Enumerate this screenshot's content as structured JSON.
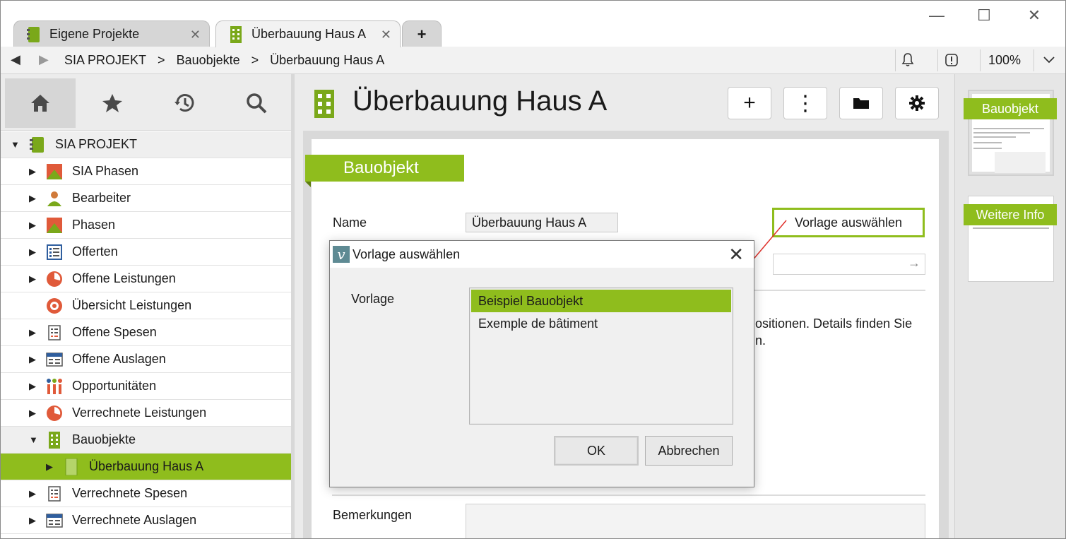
{
  "window": {
    "tabs": [
      {
        "label": "Eigene Projekte",
        "close": "✕"
      },
      {
        "label": "Überbauung Haus A",
        "close": "✕"
      }
    ],
    "new_tab": "+",
    "controls": {
      "minimize": "—",
      "maximize": "☐",
      "close": "✕"
    }
  },
  "navbar": {
    "back": "◀",
    "forward": "▶",
    "breadcrumb": [
      "SIA PROJEKT",
      "Bauobjekte",
      "Überbauung Haus A"
    ],
    "separator": ">",
    "zoom": "100%",
    "dropdown": "⌄"
  },
  "sidebar": {
    "tabs": [
      "home-icon",
      "star-icon",
      "history-icon",
      "search-icon"
    ],
    "root": "SIA PROJEKT",
    "items": [
      {
        "label": "SIA Phasen"
      },
      {
        "label": "Bearbeiter"
      },
      {
        "label": "Phasen"
      },
      {
        "label": "Offerten"
      },
      {
        "label": "Offene Leistungen"
      },
      {
        "label": "Übersicht Leistungen"
      },
      {
        "label": "Offene Spesen"
      },
      {
        "label": "Offene Auslagen"
      },
      {
        "label": "Opportunitäten"
      },
      {
        "label": "Verrechnete Leistungen"
      },
      {
        "label": "Bauobjekte"
      },
      {
        "label": "Überbauung Haus A"
      },
      {
        "label": "Verrechnete Spesen"
      },
      {
        "label": "Verrechnete Auslagen"
      }
    ]
  },
  "main": {
    "title": "Überbauung Haus A",
    "header_buttons": [
      "+",
      "⋮"
    ],
    "section": "Bauobjekt",
    "name_label": "Name",
    "name_value": "Überbauung Haus A",
    "template_button": "Vorlage auswählen",
    "partial_text_1": "ositionen. Details finden Sie",
    "partial_text_2": "n.",
    "remarks_label": "Bemerkungen"
  },
  "preview": {
    "thumbs": [
      "Bauobjekt",
      "Weitere Info"
    ]
  },
  "dialog": {
    "title": "Vorlage auswählen",
    "close": "✕",
    "label": "Vorlage",
    "options": [
      "Beispiel Bauobjekt",
      "Exemple de bâtiment"
    ],
    "selected_index": 0,
    "ok": "OK",
    "cancel": "Abbrechen"
  },
  "colors": {
    "accent": "#8fbd1d",
    "dialog_bg": "#f0f0f0"
  }
}
